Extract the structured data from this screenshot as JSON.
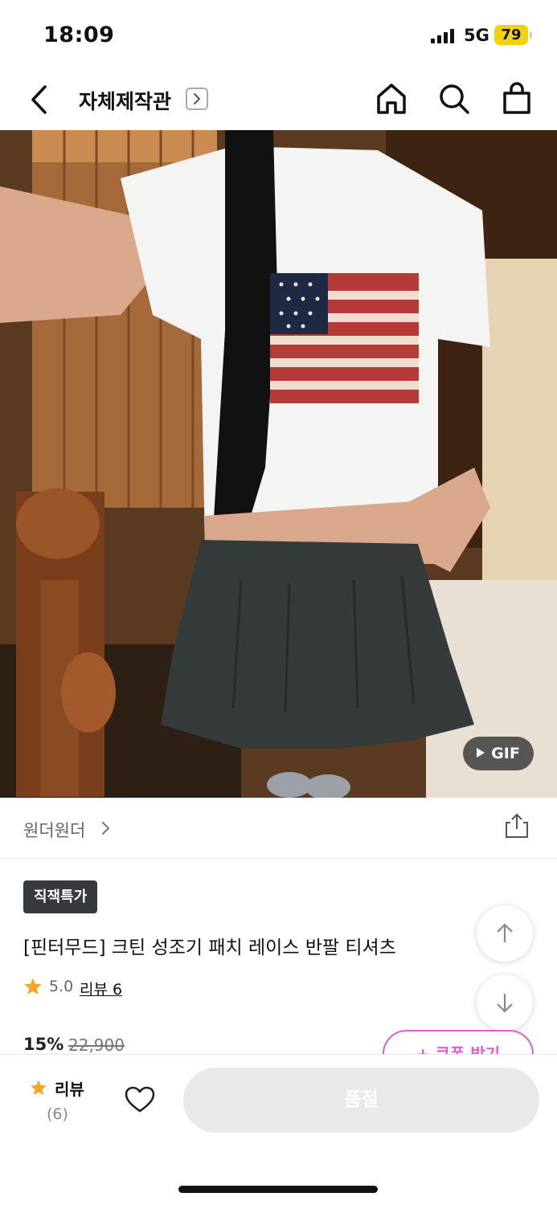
{
  "status_bar": {
    "time": "18:09",
    "network": "5G",
    "battery": "79"
  },
  "header": {
    "title": "자체제작관",
    "icons": [
      "back-icon",
      "home-icon",
      "search-icon",
      "bag-icon"
    ]
  },
  "media": {
    "badge": "GIF"
  },
  "brand": {
    "name": "원더원더"
  },
  "product": {
    "tag": "직잭특가",
    "title": "[핀터무드] 크틴 성조기 패치 레이스 반팔 티셔츠",
    "rating": "5.0",
    "review_link": "리뷰 6",
    "discount": "15%",
    "original_price": "22,900",
    "coupon_label": "+ 쿠폰 받기"
  },
  "bottom_bar": {
    "review_label": "리뷰",
    "review_count": "(6)",
    "soldout_label": "품절"
  },
  "colors": {
    "accent_pink": "#e35bd0",
    "star": "#f5a623",
    "tag_bg": "#36393d"
  }
}
